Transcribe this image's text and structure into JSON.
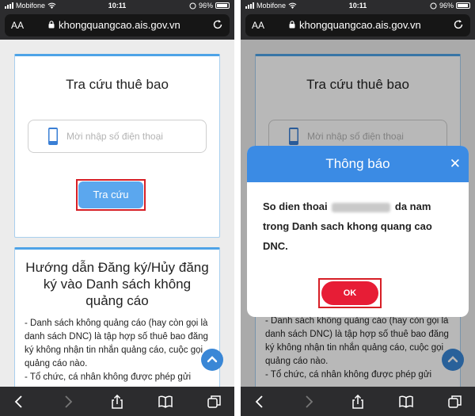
{
  "screens": {
    "left": {
      "status": {
        "carrier": "Mobifone",
        "time": "10:11",
        "battery": "96%"
      },
      "urlbar": {
        "aa": "AA",
        "url": "khongquangcao.ais.gov.vn"
      },
      "search_card": {
        "title": "Tra cứu thuê bao",
        "phone_placeholder": "Mời nhập số điện thoại",
        "search_button": "Tra cứu"
      },
      "guide_card": {
        "title": "Hướng dẫn Đăng ký/Hủy đăng ký vào Danh sách không quảng cáo",
        "paragraph1": "- Danh sách không quảng cáo (hay còn gọi là danh sách DNC) là tập hợp số thuê bao đăng ký không nhận tin nhắn quảng cáo, cuộc gọi quảng cáo nào.",
        "paragraph2": "- Tổ chức, cá nhân không được phép gửi"
      }
    },
    "right": {
      "status": {
        "carrier": "Mobifone",
        "time": "10:11",
        "battery": "96%"
      },
      "urlbar": {
        "aa": "AA",
        "url": "khongquangcao.ais.gov.vn"
      },
      "search_card": {
        "title": "Tra cứu thuê bao",
        "phone_placeholder": "Mời nhập số điện thoại"
      },
      "guide_card": {
        "paragraph1": "- Danh sách không quảng cáo (hay còn gọi là danh sách DNC) là tập hợp số thuê bao đăng ký không nhận tin nhắn quảng cáo, cuộc gọi quảng cáo nào.",
        "paragraph2": "- Tổ chức, cá nhân không được phép gửi"
      },
      "modal": {
        "title": "Thông báo",
        "close": "✕",
        "message_before": "So dien thoai",
        "message_after": "da nam trong Danh sach khong quang cao DNC.",
        "ok": "OK"
      }
    }
  },
  "colors": {
    "accent_blue": "#3b8be4",
    "button_blue": "#5ba7ee",
    "ok_red": "#e71d36",
    "highlight_red": "#d71f26"
  },
  "icons": [
    "wifi-icon",
    "signal-icon",
    "battery-icon",
    "lock-icon",
    "reload-icon",
    "mobile-phone-icon",
    "chevron-up-icon",
    "back-icon",
    "forward-icon",
    "share-icon",
    "bookmarks-icon",
    "tabs-icon",
    "close-icon"
  ]
}
